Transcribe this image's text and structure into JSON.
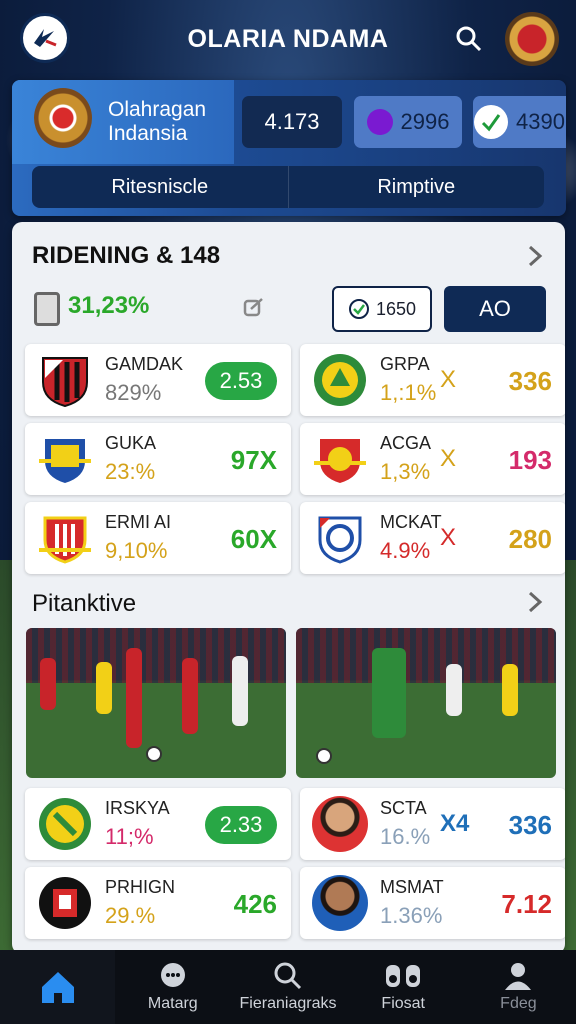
{
  "header": {
    "title": "OLARIA NDAMA"
  },
  "profile": {
    "name_line1": "Olahragan",
    "name_line2": "Indansia",
    "stat1": "4.173",
    "stat2": "2996",
    "stat3": "4390",
    "tabs": [
      "Ritesniscle",
      "Rimptive"
    ]
  },
  "ranking": {
    "title": "RIDENING & 148",
    "summary_pct": "31,23%",
    "odds_value": "1650",
    "ao_label": "AO"
  },
  "matches": [
    {
      "name": "GAMDAK",
      "pct": "829%",
      "odds": "2.53",
      "badge": true
    },
    {
      "name": "GRPA",
      "pct": "1,:1%",
      "odds": "336",
      "mark": "X"
    },
    {
      "name": "GUKA",
      "pct": "23:%",
      "odds": "97X"
    },
    {
      "name": "ACGA",
      "pct": "1,3%",
      "odds": "193",
      "mark": "X"
    },
    {
      "name": "ERMI AI",
      "pct": "9,10%",
      "odds": "60X"
    },
    {
      "name": "MCKAT",
      "pct": "4.9%",
      "odds": "280",
      "mark": "X"
    }
  ],
  "section2": {
    "title": "Pitanktive"
  },
  "players": [
    {
      "name": "IRSKYA",
      "pct": "11;%",
      "odds": "2.33",
      "badge": true
    },
    {
      "name": "SCTA",
      "pct": "16.%",
      "odds": "336",
      "mark": "X4"
    },
    {
      "name": "PRHIGN",
      "pct": "29.%",
      "odds": "426"
    },
    {
      "name": "MSMAT",
      "pct": "1.36%",
      "odds": "7.12"
    }
  ],
  "nav": [
    "Matarg",
    "Fieraniagraks",
    "Fiosat",
    "Fdeg"
  ],
  "colors": {
    "green": "#2aa82a",
    "gold": "#d4a21a",
    "pink": "#d42a6a",
    "navy": "#0f2a55",
    "nav_active": "#2a8df0"
  }
}
